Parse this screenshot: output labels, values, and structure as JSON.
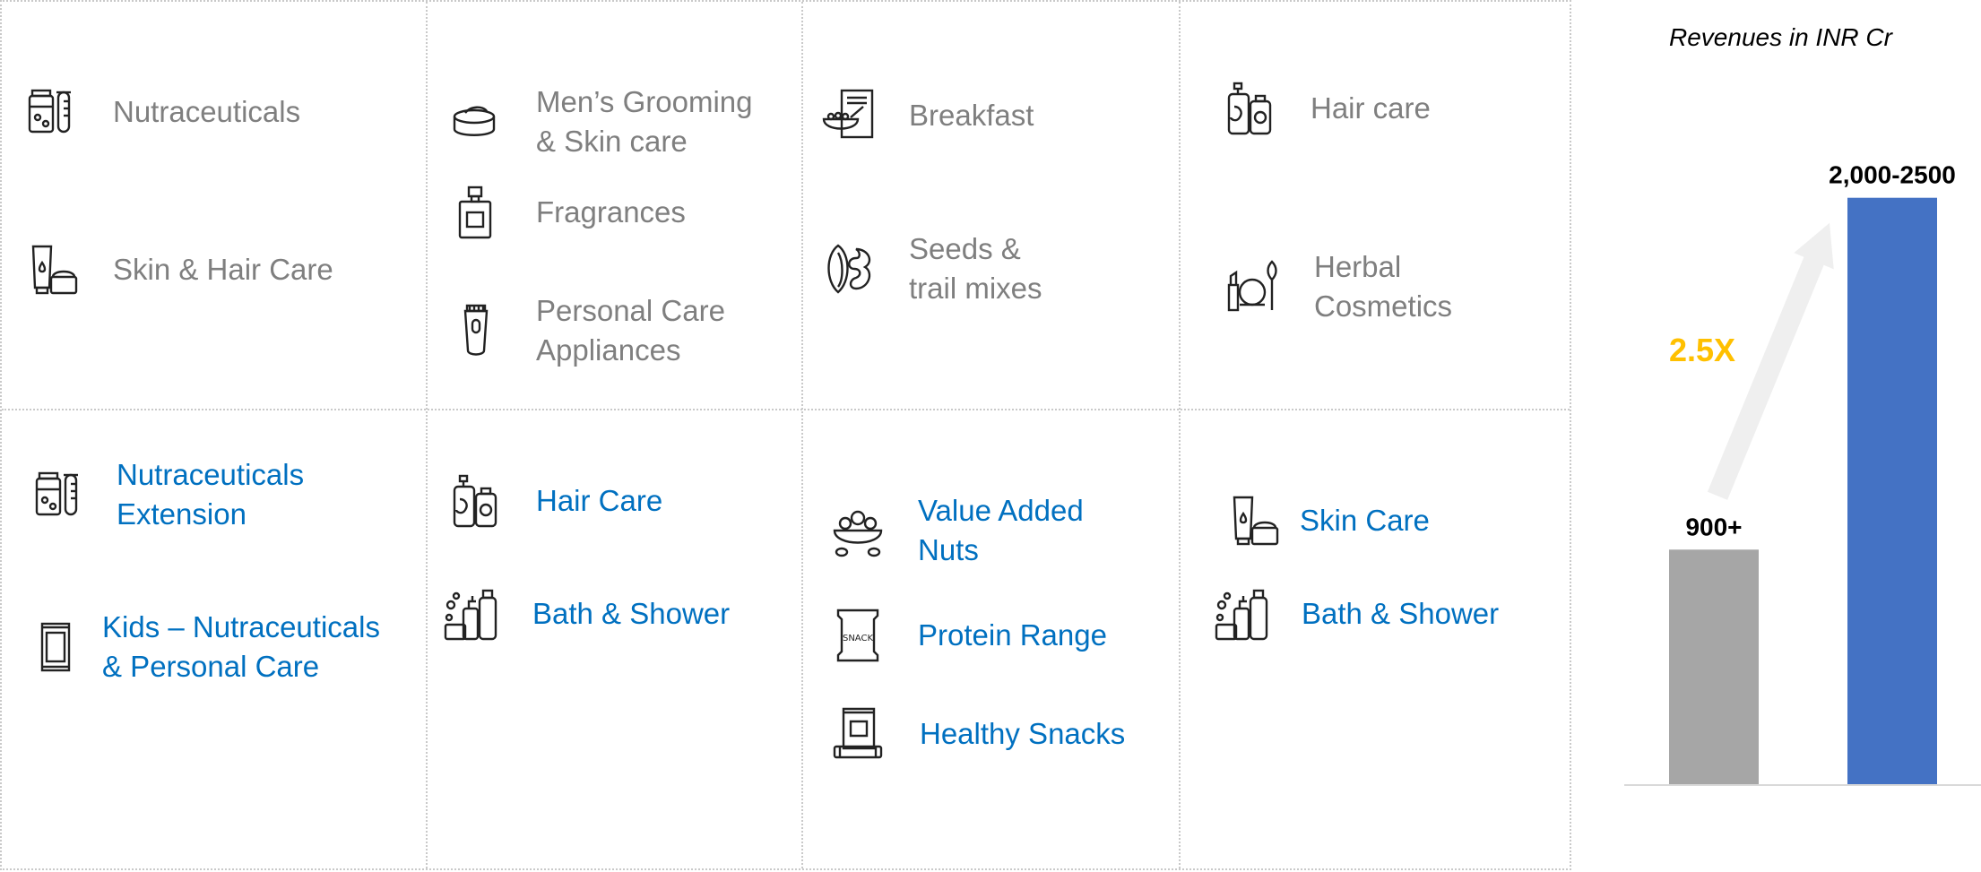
{
  "top_row": {
    "col1": [
      {
        "label": "Nutraceuticals",
        "icon": "bottle-jar-test-tube-icon"
      },
      {
        "label": "Skin & Hair Care",
        "icon": "cream-tube-jar-icon"
      }
    ],
    "col2": [
      {
        "label": "Men’s Grooming\n& Skin care",
        "icon": "cream-jar-icon"
      },
      {
        "label": "Fragrances",
        "icon": "perfume-bottle-icon"
      },
      {
        "label": "Personal Care\nAppliances",
        "icon": "trimmer-icon"
      }
    ],
    "col3": [
      {
        "label": "Breakfast",
        "icon": "cereal-box-bowl-icon"
      },
      {
        "label": "Seeds &\ntrail mixes",
        "icon": "almond-cashew-icon"
      }
    ],
    "col4": [
      {
        "label": "Hair care",
        "icon": "shampoo-bottles-icon"
      },
      {
        "label": "Herbal\nCosmetics",
        "icon": "makeup-brush-compact-icon"
      }
    ]
  },
  "bottom_row": {
    "col1": [
      {
        "label": "Nutraceuticals\nExtension",
        "icon": "bottle-jar-test-tube-icon"
      },
      {
        "label": "Kids – Nutraceuticals\n & Personal Care",
        "icon": "sachet-icon"
      }
    ],
    "col2": [
      {
        "label": "Hair Care",
        "icon": "shampoo-bottles-icon"
      },
      {
        "label": "Bath & Shower",
        "icon": "bath-products-icon"
      }
    ],
    "col3": [
      {
        "label": "Value Added\nNuts",
        "icon": "nut-bowl-icon"
      },
      {
        "label": "Protein Range",
        "icon": "snack-bar-pack-icon"
      },
      {
        "label": "Healthy Snacks",
        "icon": "snack-pouch-bar-icon"
      }
    ],
    "col4": [
      {
        "label": "Skin Care",
        "icon": "cream-tube-jar-icon"
      },
      {
        "label": "Bath & Shower",
        "icon": "bath-products-icon"
      }
    ]
  },
  "chart_data": {
    "type": "bar",
    "title": "Revenues in INR Cr",
    "categories": [
      "",
      ""
    ],
    "values": [
      900,
      2250
    ],
    "data_labels": [
      "900+",
      "2,000-2500"
    ],
    "colors": [
      "#a6a6a6",
      "#4472c4"
    ],
    "annotation": "2.5X",
    "annotation_color": "#ffc000",
    "ylim": [
      0,
      2500
    ],
    "grid": false,
    "legend": "none"
  }
}
